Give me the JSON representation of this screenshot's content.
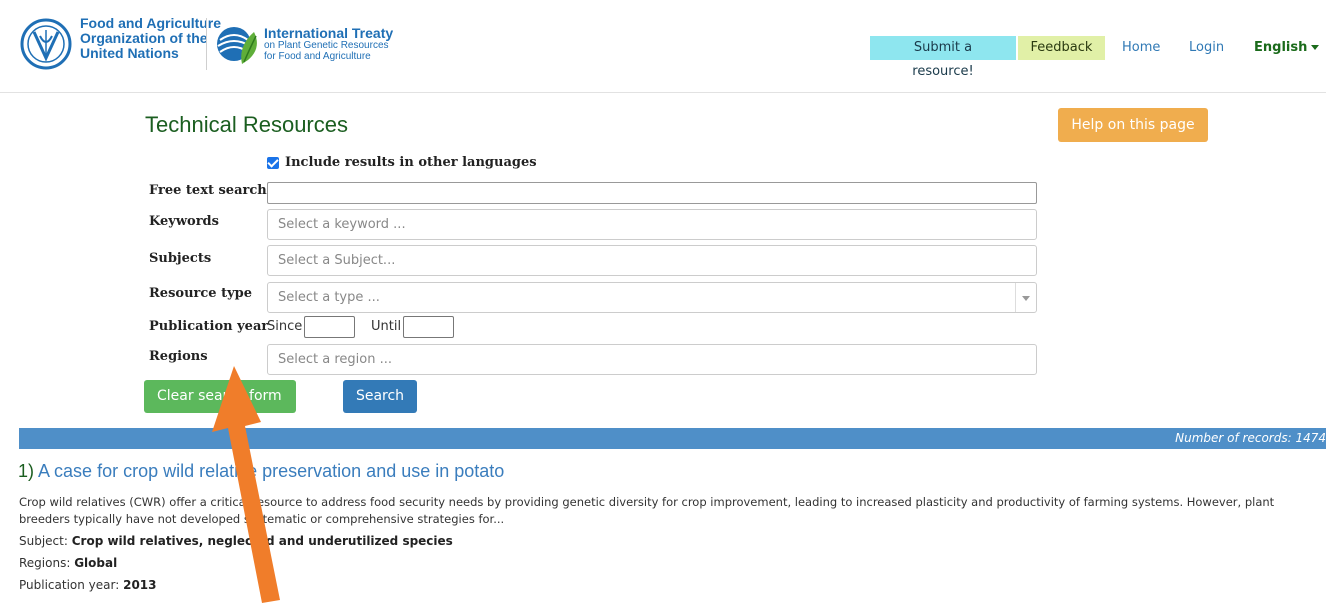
{
  "header": {
    "fao_lines": [
      "Food and Agriculture",
      "Organization of the",
      "United Nations"
    ],
    "treaty_title": "International Treaty",
    "treaty_sub1": "on Plant Genetic Resources",
    "treaty_sub2": "for Food and Agriculture",
    "submit_label": "Submit a resource!",
    "feedback_label": "Feedback",
    "home_label": "Home",
    "login_label": "Login",
    "language_label": "English"
  },
  "page": {
    "title": "Technical Resources",
    "help_label": "Help on this page"
  },
  "form": {
    "include_other_languages": "Include results in other languages",
    "free_text_label": "Free text search",
    "free_text_value": "",
    "keywords_label": "Keywords",
    "keywords_placeholder": "Select a keyword ...",
    "subjects_label": "Subjects",
    "subjects_placeholder": "Select a Subject...",
    "resource_type_label": "Resource type",
    "resource_type_placeholder": "Select a type ...",
    "pub_year_label": "Publication year",
    "since_label": "Since",
    "until_label": "Until",
    "regions_label": "Regions",
    "regions_placeholder": "Select a region ...",
    "clear_label": "Clear search form",
    "search_label": "Search"
  },
  "results": {
    "records_text": "Number of records: 1474",
    "items": [
      {
        "number": "1)",
        "title": "A case for crop wild relative preservation and use in potato",
        "description": "Crop wild relatives (CWR) offer a critical resource to address food security needs by providing genetic diversity for crop improvement, leading to increased plasticity and productivity of farming systems. However, plant breeders typically have not developed systematic or comprehensive strategies for...",
        "subject_label": "Subject:",
        "subject_value": "Crop wild relatives, neglected and underutilized species",
        "regions_label": "Regions:",
        "regions_value": "Global",
        "year_label": "Publication year:",
        "year_value": "2013"
      }
    ]
  },
  "colors": {
    "arrow": "#f07d2a",
    "accent_green": "#1b5e20",
    "link_blue": "#3a7dbd"
  }
}
